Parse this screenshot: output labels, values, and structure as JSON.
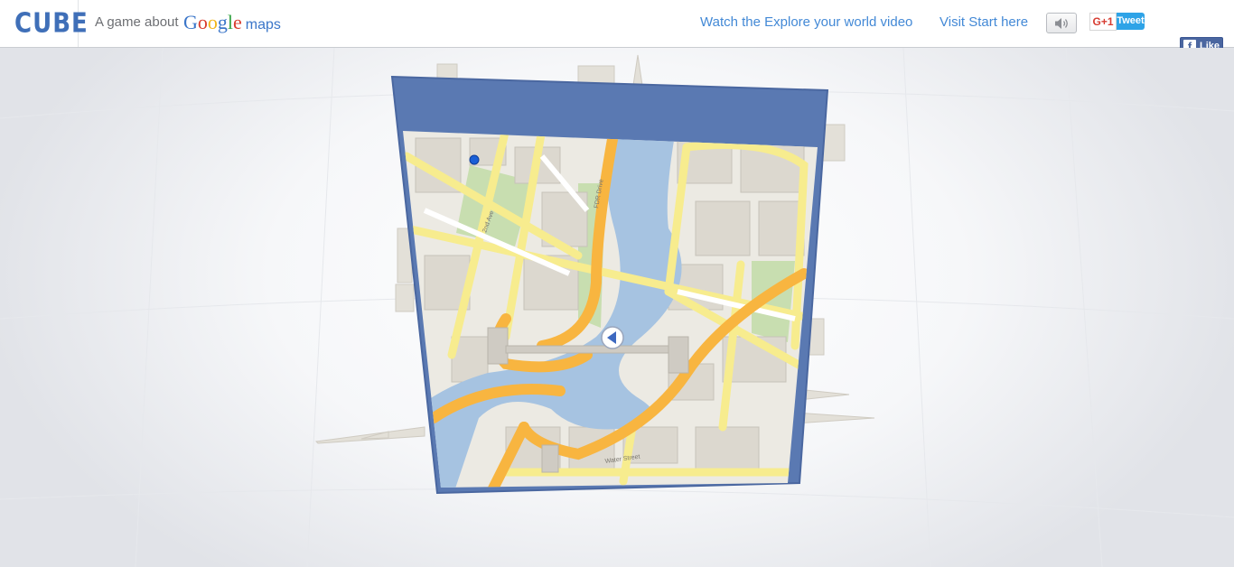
{
  "header": {
    "logo": "CUBE",
    "tagline": "A game about",
    "google_word": [
      "G",
      "o",
      "o",
      "g",
      "l",
      "e"
    ],
    "google_colors": [
      "#3b76c9",
      "#d93c2e",
      "#f1b51b",
      "#3b76c9",
      "#3aa547",
      "#d93c2e"
    ],
    "maps_word": "maps",
    "nav": {
      "video_link": "Watch the Explore your world video",
      "start_link": "Visit Start here"
    },
    "social": {
      "gplus_label": "G+1",
      "tweet_label": "Tweet",
      "fb_label": "Like",
      "fb_glyph": "f"
    }
  },
  "game": {
    "cube_frame_color": "#5a79b2",
    "road_major_color": "#f8b540",
    "road_minor_color": "#f7ec8e",
    "water_color": "#a6c3e1",
    "park_color": "#c8deb0",
    "land_color": "#eceae3",
    "player_marker_color": "#1a5fd6",
    "street_labels": [
      "2nd Ave",
      "FDR Drive",
      "Water Street"
    ]
  }
}
